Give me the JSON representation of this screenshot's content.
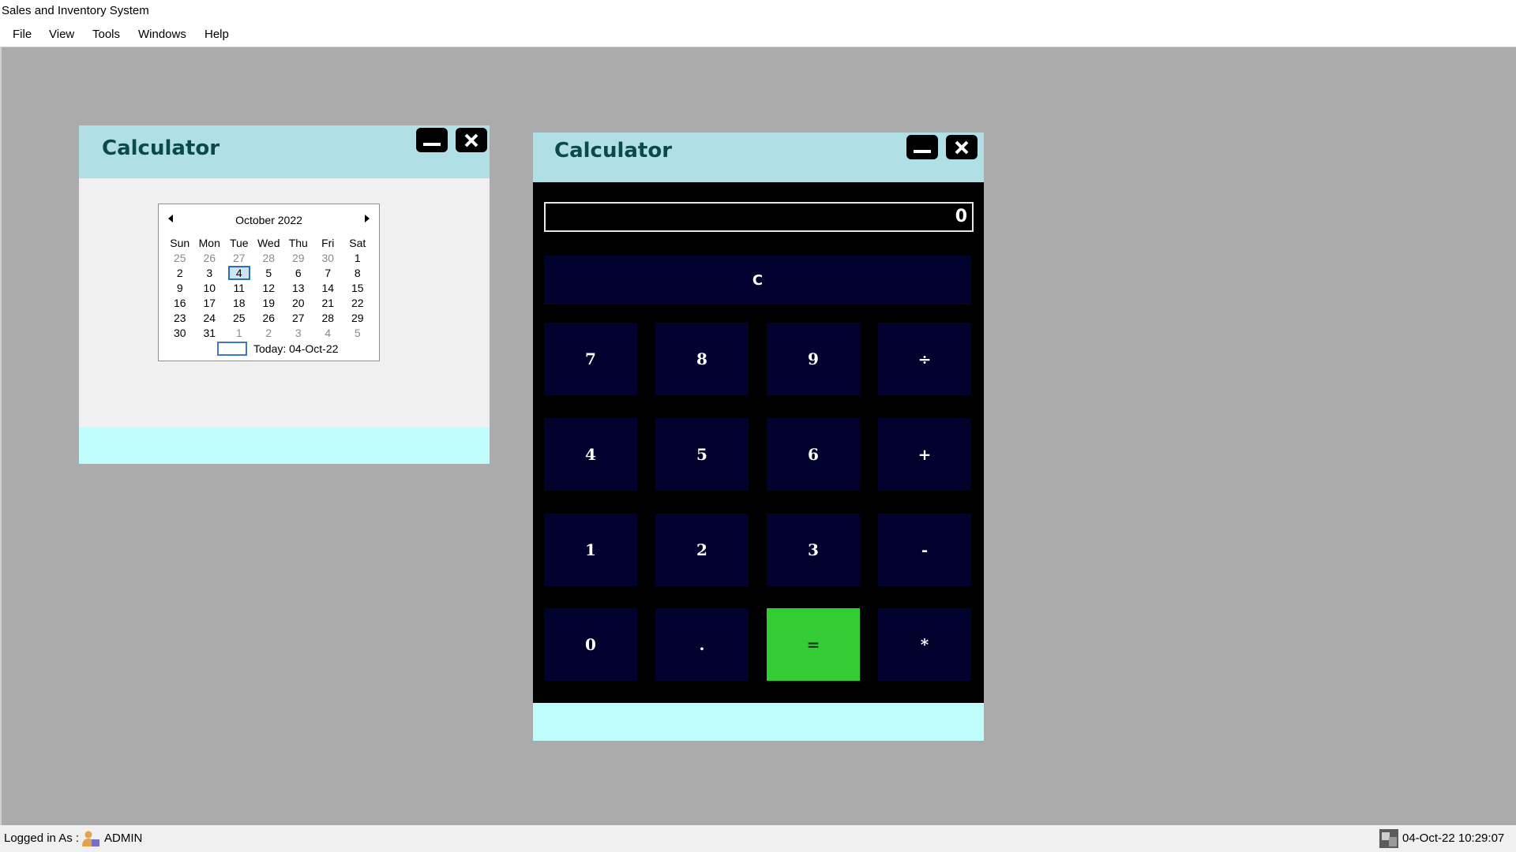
{
  "app": {
    "title": "Sales and Inventory System"
  },
  "menu": {
    "items": [
      "File",
      "View",
      "Tools",
      "Windows",
      "Help"
    ]
  },
  "status": {
    "logged_in_label": "Logged in As :",
    "user": "ADMIN",
    "datetime": "04-Oct-22 10:29:07"
  },
  "window_left": {
    "title": "Calculator",
    "calendar": {
      "month_label": "October 2022",
      "weekdays": [
        "Sun",
        "Mon",
        "Tue",
        "Wed",
        "Thu",
        "Fri",
        "Sat"
      ],
      "weeks": [
        [
          "25",
          "26",
          "27",
          "28",
          "29",
          "30",
          "1"
        ],
        [
          "2",
          "3",
          "4",
          "5",
          "6",
          "7",
          "8"
        ],
        [
          "9",
          "10",
          "11",
          "12",
          "13",
          "14",
          "15"
        ],
        [
          "16",
          "17",
          "18",
          "19",
          "20",
          "21",
          "22"
        ],
        [
          "23",
          "24",
          "25",
          "26",
          "27",
          "28",
          "29"
        ],
        [
          "30",
          "31",
          "1",
          "2",
          "3",
          "4",
          "5"
        ]
      ],
      "selected_day": "4",
      "today_label": "Today: 04-Oct-22"
    }
  },
  "window_right": {
    "title": "Calculator",
    "display_value": "0",
    "buttons": {
      "clear": "C",
      "seven": "7",
      "eight": "8",
      "nine": "9",
      "divide": "÷",
      "four": "4",
      "five": "5",
      "six": "6",
      "plus": "+",
      "one": "1",
      "two": "2",
      "three": "3",
      "minus": "-",
      "zero": "0",
      "dot": ".",
      "equals": "=",
      "multiply": "*"
    }
  },
  "colors": {
    "header": "#b0dfe5",
    "footer": "#bffcfc",
    "button": "#02022f",
    "equals_button": "#33cc33",
    "desktop": "#ababab"
  }
}
